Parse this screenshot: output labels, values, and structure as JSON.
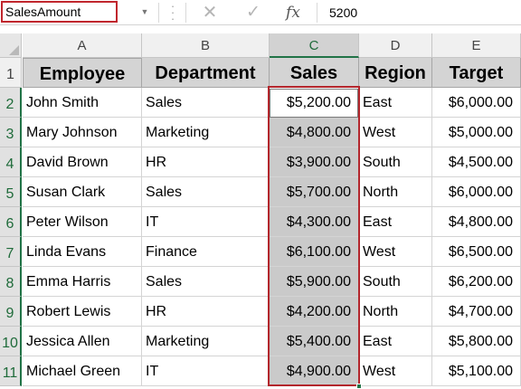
{
  "formula_bar": {
    "name_box": "SalesAmount",
    "dropdown_icon": "▼",
    "cancel_icon": "✕",
    "enter_icon": "✓",
    "function_icon": "fx",
    "formula_value": "5200"
  },
  "columns": [
    "A",
    "B",
    "C",
    "D",
    "E"
  ],
  "selected_column": "C",
  "rows": [
    "1",
    "2",
    "3",
    "4",
    "5",
    "6",
    "7",
    "8",
    "9",
    "10",
    "11"
  ],
  "table": {
    "headers": [
      "Employee",
      "Department",
      "Sales",
      "Region",
      "Target"
    ],
    "records": [
      [
        "John Smith",
        "Sales",
        "$5,200.00",
        "East",
        "$6,000.00"
      ],
      [
        "Mary Johnson",
        "Marketing",
        "$4,800.00",
        "West",
        "$5,000.00"
      ],
      [
        "David Brown",
        "HR",
        "$3,900.00",
        "South",
        "$4,500.00"
      ],
      [
        "Susan Clark",
        "Sales",
        "$5,700.00",
        "North",
        "$6,000.00"
      ],
      [
        "Peter Wilson",
        "IT",
        "$4,300.00",
        "East",
        "$4,800.00"
      ],
      [
        "Linda Evans",
        "Finance",
        "$6,100.00",
        "West",
        "$6,500.00"
      ],
      [
        "Emma Harris",
        "Sales",
        "$5,900.00",
        "South",
        "$6,200.00"
      ],
      [
        "Robert Lewis",
        "HR",
        "$4,200.00",
        "North",
        "$4,700.00"
      ],
      [
        "Jessica Allen",
        "Marketing",
        "$5,400.00",
        "East",
        "$5,800.00"
      ],
      [
        "Michael Green",
        "IT",
        "$4,900.00",
        "West",
        "$5,100.00"
      ]
    ]
  },
  "colors": {
    "selection_border": "#b3262c",
    "name_box_border": "#c0262d",
    "excel_green": "#217346",
    "header_fill": "#d4d4d4",
    "selected_fill": "#cacaca"
  }
}
